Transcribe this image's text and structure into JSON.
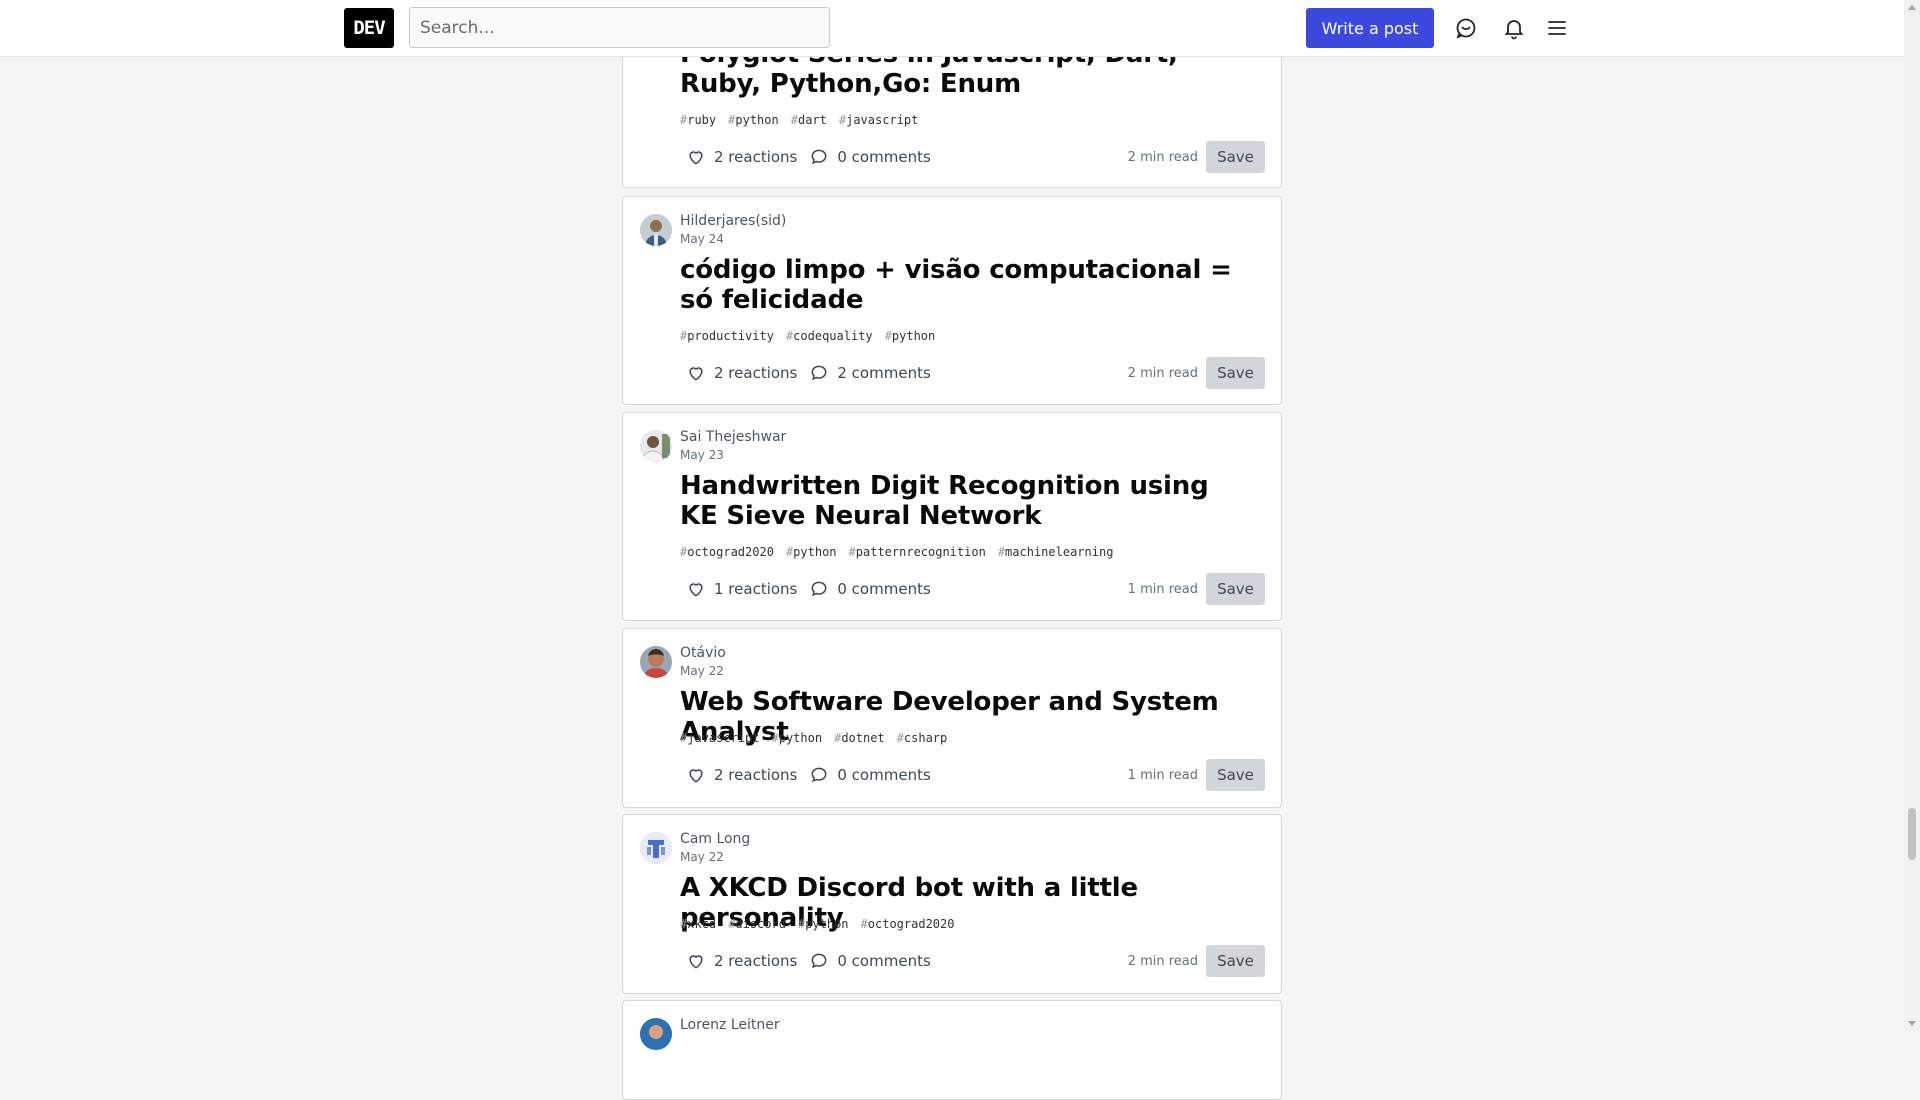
{
  "header": {
    "logo": "DEV",
    "search_placeholder": "Search...",
    "write_label": "Write a post",
    "icons": [
      "chat-icon",
      "bell-icon",
      "menu-icon"
    ]
  },
  "accent_color": "#3b49df",
  "posts": [
    {
      "author": "",
      "date": "",
      "title": "Polyglot Series in Javascript, Dart, Ruby, Python,Go: Enum",
      "tags": [
        "ruby",
        "python",
        "dart",
        "javascript"
      ],
      "reactions": "2 reactions",
      "comments": "0 comments",
      "read_time": "2 min read",
      "save": "Save"
    },
    {
      "author": "Hilderjares(sid)",
      "date": "May 24",
      "title": "código limpo + visão computacional = só felicidade",
      "tags": [
        "productivity",
        "codequality",
        "python"
      ],
      "reactions": "2 reactions",
      "comments": "2 comments",
      "read_time": "2 min read",
      "save": "Save"
    },
    {
      "author": "Sai Thejeshwar",
      "date": "May 23",
      "title": "Handwritten Digit Recognition using KE Sieve Neural Network",
      "tags": [
        "octograd2020",
        "python",
        "patternrecognition",
        "machinelearning"
      ],
      "reactions": "1 reactions",
      "comments": "0 comments",
      "read_time": "1 min read",
      "save": "Save"
    },
    {
      "author": "Otávio",
      "date": "May 22",
      "title": "Web Software Developer and System Analyst",
      "tags": [
        "javascript",
        "python",
        "dotnet",
        "csharp"
      ],
      "reactions": "2 reactions",
      "comments": "0 comments",
      "read_time": "1 min read",
      "save": "Save"
    },
    {
      "author": "Cam Long",
      "date": "May 22",
      "title": "A XKCD Discord bot with a little personality",
      "tags": [
        "xkcd",
        "discord",
        "python",
        "octograd2020"
      ],
      "reactions": "2 reactions",
      "comments": "0 comments",
      "read_time": "2 min read",
      "save": "Save"
    },
    {
      "author": "Lorenz Leitner",
      "date": "",
      "title": "",
      "tags": [],
      "reactions": "",
      "comments": "",
      "read_time": "",
      "save": ""
    }
  ]
}
